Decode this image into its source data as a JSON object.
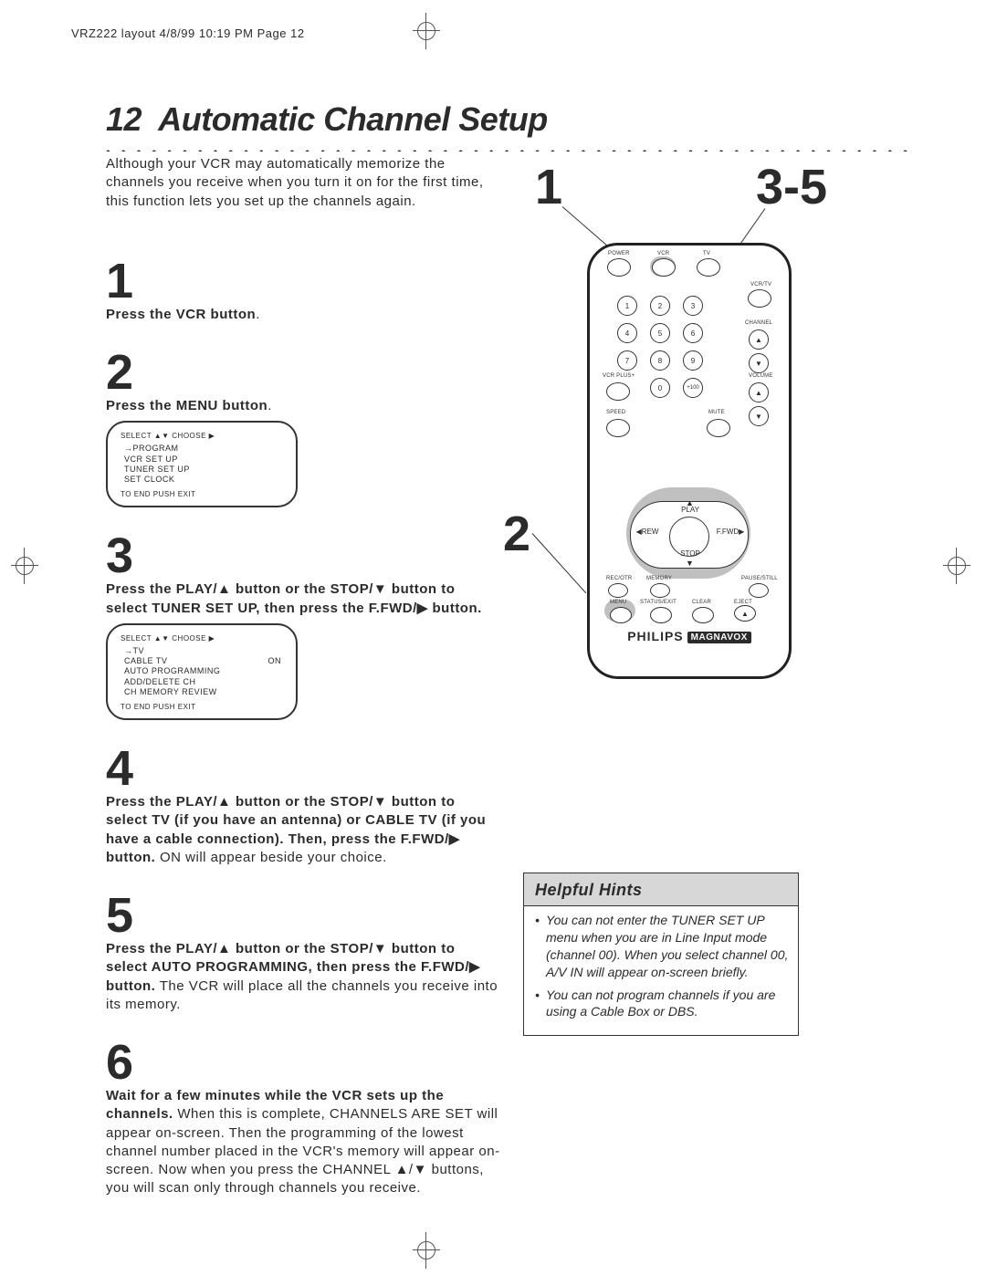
{
  "header_line": "VRZ222 layout  4/8/99 10:19 PM  Page 12",
  "page_number": "12",
  "title": "Automatic Channel Setup",
  "intro": "Although your VCR may automatically memorize the channels you receive when you turn it on for the first time, this function lets you set up the channels again.",
  "steps": [
    {
      "n": "1",
      "bold": "Press the VCR button",
      "tail": "."
    },
    {
      "n": "2",
      "bold": "Press the MENU button",
      "tail": "."
    },
    {
      "n": "3",
      "bold": "Press the PLAY/▲ button or the STOP/▼ button to select TUNER SET UP, then press the F.FWD/▶ button.",
      "tail": ""
    },
    {
      "n": "4",
      "bold": "Press the PLAY/▲ button or the STOP/▼ button to select TV (if you have an antenna) or CABLE TV (if you have a cable connection). Then, press the F.FWD/▶ button.",
      "tail": " ON will appear beside your choice."
    },
    {
      "n": "5",
      "bold": "Press the PLAY/▲ button or the STOP/▼ button to select AUTO PROGRAMMING, then press the F.FWD/▶ button.",
      "tail": " The VCR will place all the channels you receive into its memory."
    },
    {
      "n": "6",
      "bold": "Wait for a few minutes while the VCR sets up the channels.",
      "tail": " When this is complete, CHANNELS ARE SET will appear on-screen. Then the programming of the lowest channel number placed in the VCR's memory will appear on-screen. Now when you press the CHANNEL ▲/▼ buttons, you will scan only through channels you receive."
    }
  ],
  "osd1": {
    "header": "SELECT ▲▼ CHOOSE ▶",
    "items": [
      "→PROGRAM",
      "  VCR SET UP",
      "  TUNER SET UP",
      "  SET CLOCK"
    ],
    "footer": "TO END PUSH EXIT"
  },
  "osd2": {
    "header": "SELECT ▲▼ CHOOSE ▶",
    "items": [
      "→TV",
      "  CABLE TV",
      "  AUTO PROGRAMMING",
      "  ADD/DELETE CH",
      "  CH MEMORY REVIEW"
    ],
    "on_for": "  CABLE TV",
    "on_label": "ON",
    "footer": "TO END PUSH EXIT"
  },
  "callouts": {
    "c1": "1",
    "c35": "3-5",
    "c2": "2"
  },
  "remote": {
    "labels": {
      "power": "POWER",
      "vcr": "VCR",
      "tv": "TV",
      "vcrtv": "VCR/TV",
      "channel": "CHANNEL",
      "volume": "VOLUME",
      "vcrplus": "VCR PLUS+",
      "speed": "SPEED",
      "mute": "MUTE",
      "play": "PLAY",
      "rew": "REW",
      "ffwd": "F.FWD",
      "stop": "STOP",
      "recotr": "REC/OTR",
      "memory": "MEMORY",
      "pausestill": "PAUSE/STILL",
      "menu": "MENU",
      "statusexit": "STATUS/EXIT",
      "clear": "CLEAR",
      "eject": "EJECT"
    },
    "digits": [
      "1",
      "2",
      "3",
      "4",
      "5",
      "6",
      "7",
      "8",
      "9",
      "0",
      "+100"
    ]
  },
  "brand": {
    "name": "PHILIPS",
    "sub": "MAGNAVOX"
  },
  "hints": {
    "title": "Helpful Hints",
    "items": [
      "You can not enter the TUNER SET UP menu when you are in Line Input mode (channel 00). When you select channel 00, A/V IN will appear on-screen briefly.",
      "You can not program channels if you are using a Cable Box or DBS."
    ]
  }
}
